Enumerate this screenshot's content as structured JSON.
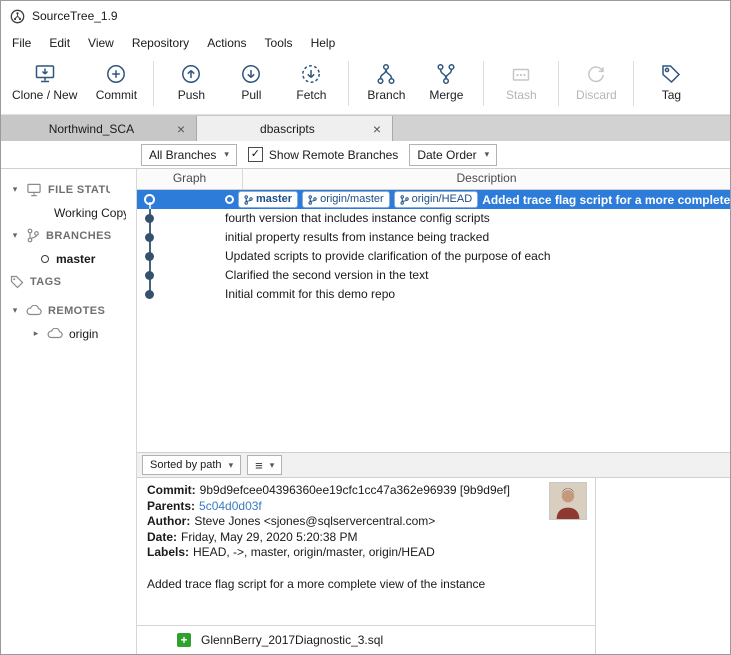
{
  "window": {
    "title": "SourceTree_1.9"
  },
  "icons": {
    "chevron_down": "▾",
    "chevron_right": "▸",
    "close": "×",
    "check": "✓",
    "hamburger": "≡",
    "plus": "+"
  },
  "menu": {
    "items": [
      {
        "label": "File"
      },
      {
        "label": "Edit"
      },
      {
        "label": "View"
      },
      {
        "label": "Repository"
      },
      {
        "label": "Actions"
      },
      {
        "label": "Tools"
      },
      {
        "label": "Help"
      }
    ]
  },
  "toolbar": {
    "buttons": [
      {
        "label": "Clone / New",
        "enabled": true
      },
      {
        "label": "Commit",
        "enabled": true
      },
      {
        "label": "Push",
        "enabled": true
      },
      {
        "label": "Pull",
        "enabled": true
      },
      {
        "label": "Fetch",
        "enabled": true
      },
      {
        "label": "Branch",
        "enabled": true
      },
      {
        "label": "Merge",
        "enabled": true
      },
      {
        "label": "Stash",
        "enabled": false
      },
      {
        "label": "Discard",
        "enabled": false
      },
      {
        "label": "Tag",
        "enabled": true
      }
    ]
  },
  "tabs": [
    {
      "label": "Northwind_SCA",
      "active": false
    },
    {
      "label": "dbascripts",
      "active": true
    }
  ],
  "filter_bar": {
    "branch_filter": "All Branches",
    "show_remote_label": "Show Remote Branches",
    "show_remote_checked": true,
    "sort_order": "Date Order"
  },
  "sidebar": {
    "sections": [
      {
        "label": "FILE STATUS",
        "children": [
          {
            "label": "Working Copy"
          }
        ]
      },
      {
        "label": "BRANCHES",
        "children": [
          {
            "label": "master"
          }
        ]
      },
      {
        "label": "TAGS",
        "children": []
      },
      {
        "label": "REMOTES",
        "children": [
          {
            "label": "origin"
          }
        ]
      }
    ]
  },
  "graph": {
    "columns": [
      {
        "label": "Graph"
      },
      {
        "label": "Description"
      }
    ],
    "rows": [
      {
        "selected": true,
        "badges": [
          "master",
          "origin/master",
          "origin/HEAD"
        ],
        "description": "Added trace flag script for a more complete view of the instance"
      },
      {
        "selected": false,
        "badges": [],
        "description": "fourth version that includes instance config scripts"
      },
      {
        "selected": false,
        "badges": [],
        "description": "initial property results from instance being tracked"
      },
      {
        "selected": false,
        "badges": [],
        "description": "Updated scripts to provide clarification of the purpose of each"
      },
      {
        "selected": false,
        "badges": [],
        "description": "Clarified the second version in the text"
      },
      {
        "selected": false,
        "badges": [],
        "description": "Initial commit for this demo repo"
      }
    ]
  },
  "detail_toolbar": {
    "sort_by": "Sorted by path"
  },
  "commit_details": {
    "commit_label": "Commit:",
    "commit_value": "9b9d9efcee04396360ee19cfc1cc47a362e96939 [9b9d9ef]",
    "parents_label": "Parents:",
    "parents_value": "5c04d0d03f",
    "author_label": "Author:",
    "author_value": "Steve Jones <sjones@sqlservercentral.com>",
    "date_label": "Date:",
    "date_value": "Friday, May 29, 2020 5:20:38 PM",
    "labels_label": "Labels:",
    "labels_value": "HEAD, ->, master, origin/master, origin/HEAD",
    "message": "Added trace flag script for a more complete view of the instance"
  },
  "files": [
    {
      "name": "GlennBerry_2017Diagnostic_3.sql",
      "status": "added"
    }
  ],
  "colors": {
    "selection": "#2e7cd9",
    "link": "#3a7bbf",
    "badge_border": "#86aed6",
    "added_green": "#2ea12e",
    "icon_navy": "#2e567e"
  }
}
